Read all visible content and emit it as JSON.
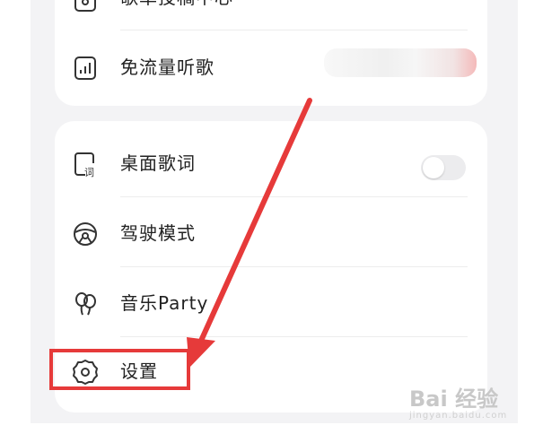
{
  "menu_top": {
    "items": [
      {
        "label": "歌单投稿中心",
        "icon": "playlist-submit-icon"
      },
      {
        "label": "免流量听歌",
        "icon": "signal-bars-icon"
      }
    ]
  },
  "menu_main": {
    "items": [
      {
        "label": "桌面歌词",
        "icon": "desktop-lyrics-icon"
      },
      {
        "label": "驾驶模式",
        "icon": "steering-wheel-icon"
      },
      {
        "label": "音乐Party",
        "icon": "balloons-icon"
      },
      {
        "label": "设置",
        "icon": "gear-icon"
      }
    ],
    "desktop_lyrics_toggle": "off"
  },
  "annotation": {
    "arrow_color": "#e63a3a",
    "highlight_color": "#e63a3a"
  },
  "watermark": {
    "text": "Bai 经验",
    "sub": "jingyan.baidu.com"
  }
}
